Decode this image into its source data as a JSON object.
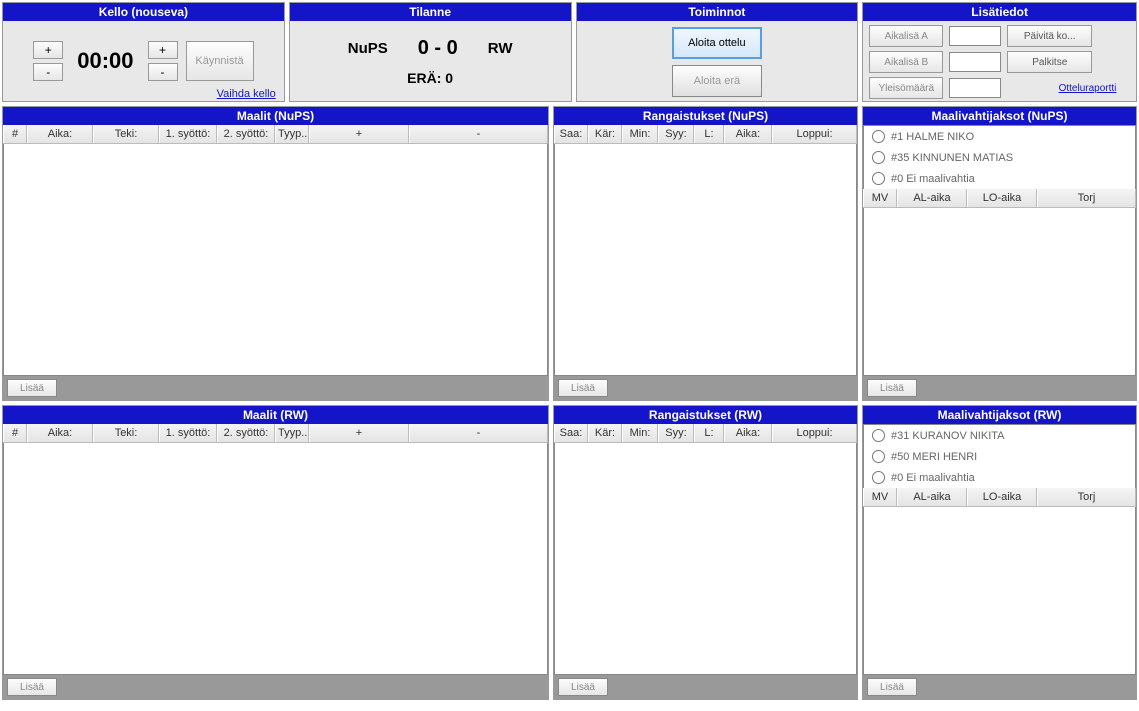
{
  "clock": {
    "title": "Kello (nouseva)",
    "time": "00:00",
    "plus": "+",
    "minus": "-",
    "start": "Käynnistä",
    "swap_link": "Vaihda kello"
  },
  "score": {
    "title": "Tilanne",
    "home": "NuPS",
    "away": "RW",
    "value": "0 - 0",
    "period": "ERÄ: 0"
  },
  "actions": {
    "title": "Toiminnot",
    "start_match": "Aloita ottelu",
    "start_period": "Aloita erä"
  },
  "info": {
    "title": "Lisätiedot",
    "timeout_a": "Aikalisä A",
    "timeout_b": "Aikalisä B",
    "attendance": "Yleisömäärä",
    "refresh": "Päivitä ko...",
    "reward": "Palkitse",
    "report": "Otteluraportti",
    "val_a": "",
    "val_b": "",
    "val_att": ""
  },
  "goals_home": {
    "title": "Maalit (NuPS)",
    "cols": [
      "#",
      "Aika:",
      "Teki:",
      "1. syöttö:",
      "2. syöttö:",
      "Tyyp...",
      "+",
      "-"
    ],
    "add": "Lisää"
  },
  "goals_away": {
    "title": "Maalit (RW)",
    "cols": [
      "#",
      "Aika:",
      "Teki:",
      "1. syöttö:",
      "2. syöttö:",
      "Tyyp...",
      "+",
      "-"
    ],
    "add": "Lisää"
  },
  "pen_home": {
    "title": "Rangaistukset (NuPS)",
    "cols": [
      "Saa:",
      "Kär:",
      "Min:",
      "Syy:",
      "L:",
      "Aika:",
      "Loppui:"
    ],
    "add": "Lisää"
  },
  "pen_away": {
    "title": "Rangaistukset (RW)",
    "cols": [
      "Saa:",
      "Kär:",
      "Min:",
      "Syy:",
      "L:",
      "Aika:",
      "Loppui:"
    ],
    "add": "Lisää"
  },
  "gk_home": {
    "title": "Maalivahtijaksot (NuPS)",
    "options": [
      "#1 HALME NIKO",
      "#35 KINNUNEN MATIAS",
      "#0 Ei maalivahtia"
    ],
    "cols": [
      "MV",
      "AL-aika",
      "LO-aika",
      "Torj"
    ],
    "add": "Lisää"
  },
  "gk_away": {
    "title": "Maalivahtijaksot (RW)",
    "options": [
      "#31 KURANOV NIKITA",
      "#50 MERI HENRI",
      "#0 Ei maalivahtia"
    ],
    "cols": [
      "MV",
      "AL-aika",
      "LO-aika",
      "Torj"
    ],
    "add": "Lisää"
  }
}
